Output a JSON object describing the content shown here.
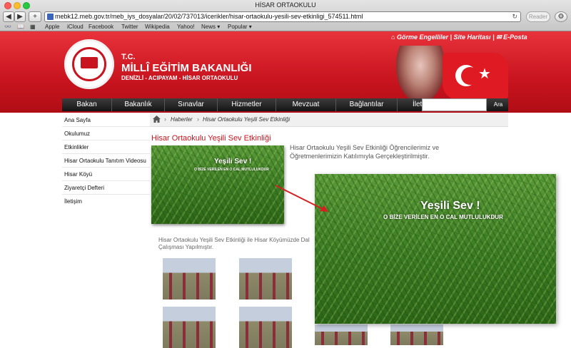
{
  "browser": {
    "window_title": "HİSAR ORTAOKULU",
    "url": "mebk12.meb.gov.tr/meb_iys_dosyalar/20/02/737013/icerikler/hisar-ortaokulu-yesili-sev-etkinligi_574511.html",
    "reader_label": "Reader",
    "add_label": "+",
    "bookmarks": [
      "Apple",
      "iCloud",
      "Facebook",
      "Twitter",
      "Wikipedia",
      "Yahoo!",
      "News ▾",
      "Popular ▾"
    ]
  },
  "header": {
    "top_links": [
      "Görme Engelliler",
      "Site Haritası",
      "E-Posta"
    ],
    "tc": "T.C.",
    "ministry": "MİLLÎ EĞİTİM BAKANLIĞI",
    "subtitle": "DENİZLİ - ACIPAYAM - HİSAR ORTAOKULU"
  },
  "nav": {
    "items": [
      "Bakan",
      "Bakanlık",
      "Sınavlar",
      "Hizmetler",
      "Mevzuat",
      "Bağlantılar",
      "İletişim"
    ],
    "search_button": "Ara"
  },
  "sidebar": {
    "items": [
      "Ana Sayfa",
      "Okulumuz",
      "Etkinlikler",
      "Hisar Ortaokulu Tanıtım Videosu",
      "Hisar Köyü",
      "Ziyaretçi Defteri",
      "İletişim"
    ]
  },
  "breadcrumb": {
    "items": [
      "Haberler",
      "Hisar Ortaokulu Yeşili Sev Etkinliği"
    ]
  },
  "article": {
    "title": "Hisar Ortaokulu Yeşili Sev Etkinliği",
    "intro": "Hisar Ortaokulu Yeşili Sev Etkinliği Öğrencilerimiz ve Öğretmenlerimizin Katılımıyla Gerçekleştirilmiştir.",
    "body": "Hisar Ortaokulu Yeşili Sev Etkinliği ile Hisar Köyümüzde Dal Çalışması Yapılmıştır.",
    "photo_title": "Yeşili Sev !",
    "photo_caption": "O BİZE VERİLEN EN O CAL MUTLULUKDUR"
  },
  "colors": {
    "brand_red": "#c8141e",
    "nav_dark": "#1f1f1f",
    "annotation_arrow": "#d42020"
  }
}
